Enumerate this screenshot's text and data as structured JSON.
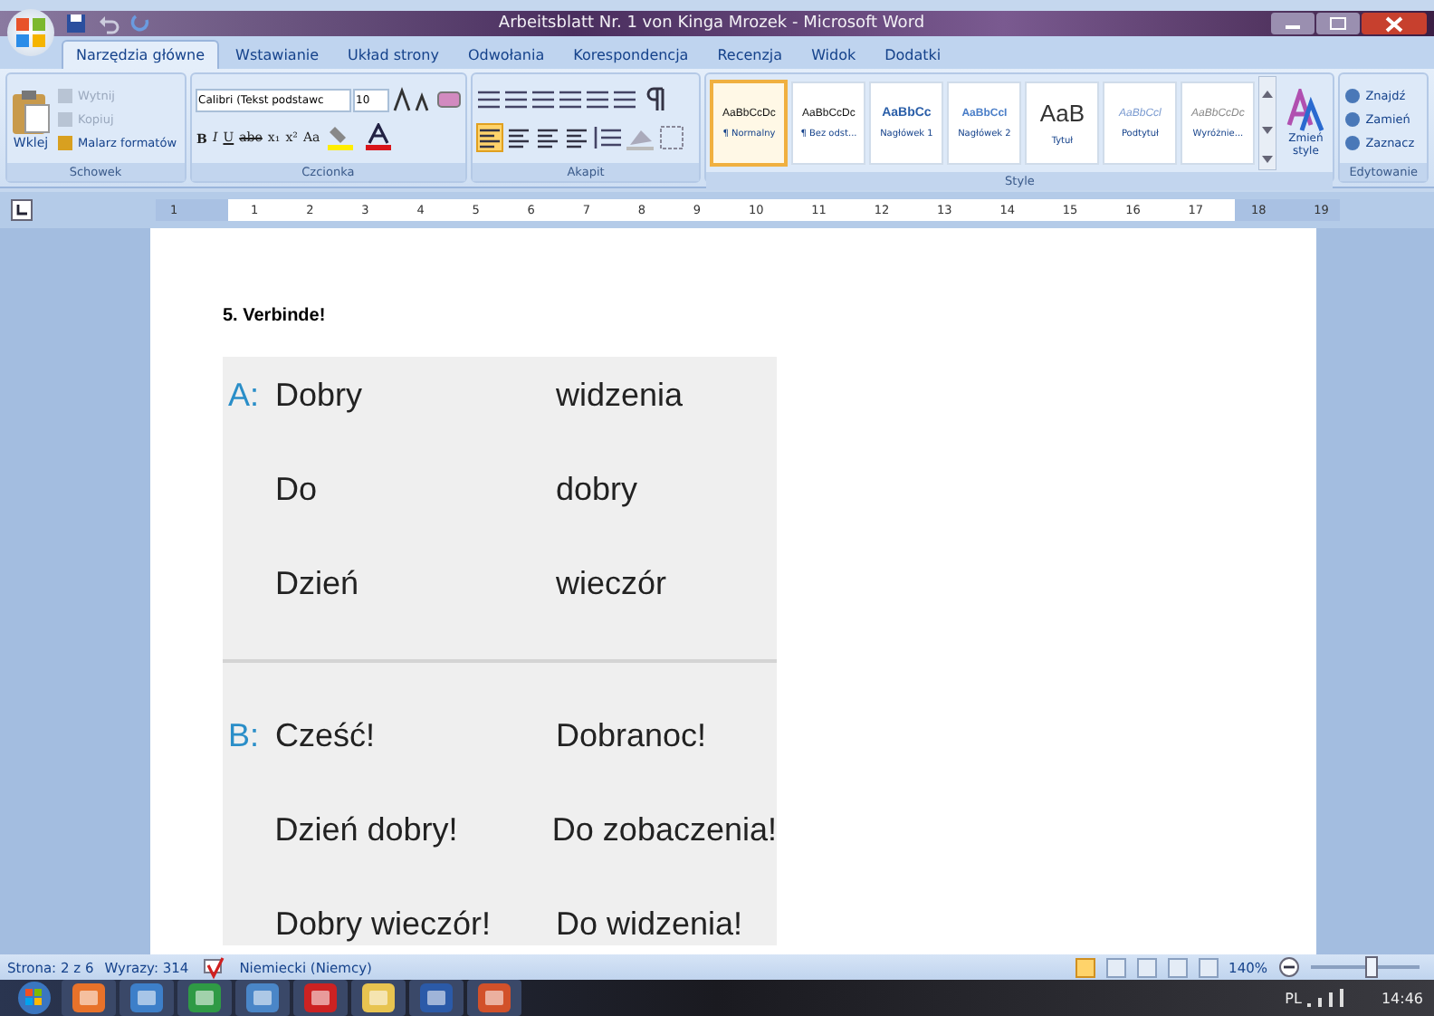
{
  "window": {
    "title": "Arbeitsblatt Nr. 1 von Kinga Mrozek - Microsoft Word"
  },
  "tabs": [
    {
      "label": "Narzędzia główne",
      "selected": true
    },
    {
      "label": "Wstawianie",
      "selected": false
    },
    {
      "label": "Układ strony",
      "selected": false
    },
    {
      "label": "Odwołania",
      "selected": false
    },
    {
      "label": "Korespondencja",
      "selected": false
    },
    {
      "label": "Recenzja",
      "selected": false
    },
    {
      "label": "Widok",
      "selected": false
    },
    {
      "label": "Dodatki",
      "selected": false
    }
  ],
  "clipboard": {
    "label": "Schowek",
    "paste": "Wklej",
    "items": [
      {
        "label": "Wytnij",
        "disabled": true
      },
      {
        "label": "Kopiuj",
        "disabled": true
      },
      {
        "label": "Malarz formatów",
        "disabled": false
      }
    ]
  },
  "font": {
    "label": "Czcionka",
    "family": "Calibri (Tekst podstawc",
    "size": "10",
    "format_buttons": [
      "B",
      "I",
      "U",
      "abe",
      "x₁",
      "x²",
      "Aa"
    ]
  },
  "paragraph": {
    "label": "Akapit",
    "alignments": [
      {
        "selected": true
      },
      {
        "selected": false
      },
      {
        "selected": false
      },
      {
        "selected": false
      }
    ]
  },
  "styles": {
    "label": "Style",
    "change": "Zmień style",
    "items": [
      {
        "preview": "AaBbCcDc",
        "label": "¶ Normalny",
        "kind": "normal",
        "selected": true
      },
      {
        "preview": "AaBbCcDc",
        "label": "¶ Bez odst...",
        "kind": "normal",
        "selected": false
      },
      {
        "preview": "AaBbCc",
        "label": "Nagłówek 1",
        "kind": "heading1",
        "selected": false
      },
      {
        "preview": "AaBbCcI",
        "label": "Nagłówek 2",
        "kind": "heading2",
        "selected": false
      },
      {
        "preview": "AaB",
        "label": "Tytuł",
        "kind": "title",
        "selected": false
      },
      {
        "preview": "AaBbCcl",
        "label": "Podtytuł",
        "kind": "subtitle",
        "selected": false
      },
      {
        "preview": "AaBbCcDc",
        "label": "Wyróżnie...",
        "kind": "emphasis",
        "selected": false
      }
    ]
  },
  "editing": {
    "label": "Edytowanie",
    "items": [
      "Znajdź",
      "Zamień",
      "Zaznacz"
    ]
  },
  "ruler": {
    "marks": [
      "1",
      "1",
      "2",
      "3",
      "4",
      "5",
      "6",
      "7",
      "8",
      "9",
      "10",
      "11",
      "12",
      "13",
      "14",
      "15",
      "16",
      "17",
      "18",
      "19"
    ]
  },
  "document": {
    "heading": "5. Verbinde!",
    "sections": [
      {
        "letter": "A:",
        "pairs": [
          [
            "Dobry",
            "widzenia"
          ],
          [
            "Do",
            "dobry"
          ],
          [
            "Dzień",
            "wieczór"
          ]
        ]
      },
      {
        "letter": "B:",
        "pairs": [
          [
            "Cześć!",
            "Dobranoc!"
          ],
          [
            "Dzień dobry!",
            "Do zobaczenia!"
          ],
          [
            "Dobry wieczór!",
            "Do widzenia!"
          ]
        ]
      }
    ]
  },
  "status_bar": {
    "page": "Strona: 2 z 6",
    "words": "Wyrazy: 314",
    "language": "Niemiecki (Niemcy)",
    "views": [
      {
        "selected": true
      },
      {
        "selected": false
      },
      {
        "selected": false
      },
      {
        "selected": false
      },
      {
        "selected": false
      }
    ],
    "zoom": "140%",
    "zoom_slider": {
      "level": 0.55
    }
  },
  "taskbar": {
    "language": "PL",
    "time": "14:46"
  }
}
